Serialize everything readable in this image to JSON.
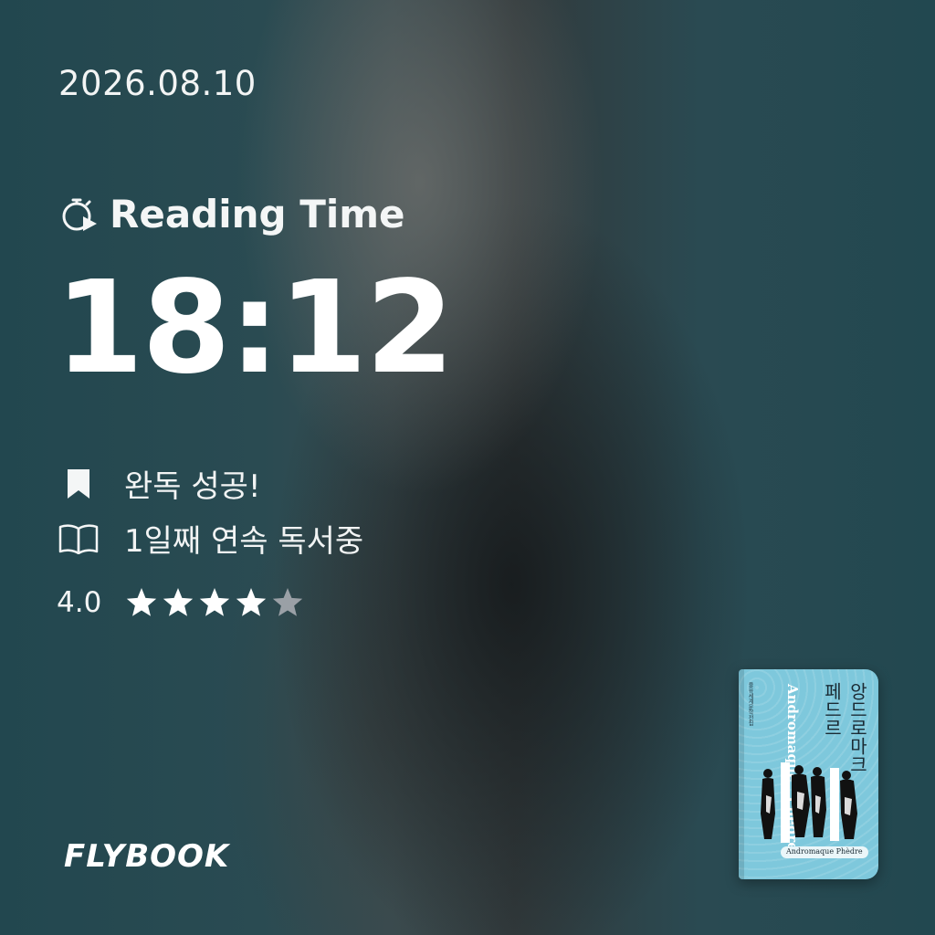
{
  "date": "2026.08.10",
  "reading_time": {
    "label": "Reading Time",
    "icon": "stopwatch-play-icon",
    "value": "18:12"
  },
  "status": {
    "complete": {
      "icon": "bookmark-icon",
      "text": "완독 성공!"
    },
    "streak": {
      "icon": "open-book-icon",
      "text": "1일째 연속 독서중"
    }
  },
  "rating": {
    "value": "4.0",
    "stars_filled": 4,
    "stars_total": 5,
    "filled_color": "#ffffff",
    "empty_color": "#9aa0a6"
  },
  "brand": "FLYBOOK",
  "book": {
    "title_ko_1": "앙드로마크",
    "title_ko_2": "페드르",
    "title_fr": "Andromaque · Phèdre",
    "cover_label": "Andromaque Phèdre",
    "cover_color": "#7ec8dc"
  }
}
